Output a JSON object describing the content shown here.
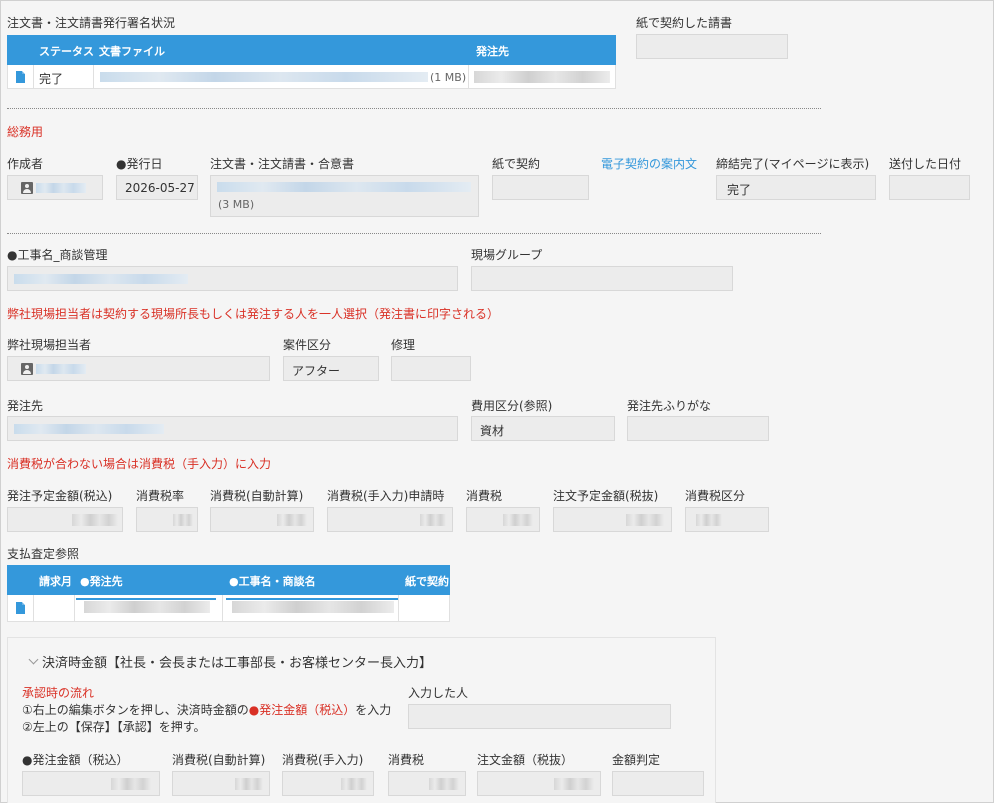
{
  "top": {
    "status_section_label": "注文書・注文請書発行署名状況",
    "paper_contract_request_label": "紙で契約した請書",
    "table": {
      "headers": [
        "ステータス",
        "文書ファイル",
        "発注先"
      ],
      "row": {
        "icon": "document-icon",
        "status": "完了",
        "file_size": "(1 MB)"
      }
    }
  },
  "general_affairs": {
    "section_label": "総務用",
    "creator_label": "作成者",
    "issue_date_label": "●発行日",
    "issue_date_value": "2026-05-27",
    "documents_label": "注文書・注文請書・合意書",
    "documents_size": "(3 MB)",
    "paper_contract_label": "紙で契約",
    "e_contract_link": "電子契約の案内文",
    "completion_label": "締結完了(マイページに表示)",
    "completion_value": "完了",
    "sent_date_label": "送付した日付"
  },
  "project": {
    "project_name_label": "●工事名_商談管理",
    "site_group_label": "現場グループ",
    "manager_note": "弊社現場担当者は契約する現場所長もしくは発注する人を一人選択（発注書に印字される）",
    "manager_label": "弊社現場担当者",
    "case_category_label": "案件区分",
    "case_category_value": "アフター",
    "repair_label": "修理",
    "supplier_label": "発注先",
    "cost_category_label": "費用区分(参照)",
    "cost_category_value": "資材",
    "supplier_kana_label": "発注先ふりがな",
    "tax_note": "消費税が合わない場合は消費税（手入力）に入力"
  },
  "amounts": {
    "labels": [
      "発注予定金額(税込)",
      "消費税率",
      "消費税(自動計算)",
      "消費税(手入力)申請時",
      "消費税",
      "注文予定金額(税抜)",
      "消費税区分"
    ]
  },
  "payment": {
    "section_label": "支払査定参照",
    "headers": [
      "請求月",
      "●発注先",
      "●工事名・商談名",
      "紙で契約"
    ],
    "row_icon": "document-icon"
  },
  "settlement": {
    "title": "決済時金額【社長・会長または工事部長・お客様センター長入力】",
    "flow_title": "承認時の流れ",
    "step1_prefix": "①右上の編集ボタンを押し、決済時金額の",
    "step1_highlight": "●発注金額（税込）",
    "step1_suffix": "を入力",
    "step2": "②左上の【保存】【承認】を押す。",
    "entered_by_label": "入力した人",
    "labels": [
      "●発注金額（税込）",
      "消費税(自動計算)",
      "消費税(手入力)",
      "消費税",
      "注文金額（税抜）",
      "金額判定"
    ]
  },
  "colors": {
    "accent": "#3498db",
    "warning": "#d93025"
  }
}
